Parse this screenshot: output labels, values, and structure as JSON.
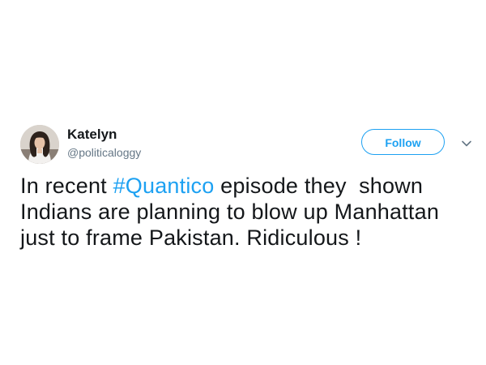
{
  "author": {
    "display_name": "Katelyn",
    "handle": "@politicaloggy",
    "avatar_icon": "profile-photo"
  },
  "actions": {
    "follow_label": "Follow",
    "menu_icon": "chevron-down-icon"
  },
  "tweet": {
    "line1_before": "In recent ",
    "hashtag": "#Quantico",
    "line1_after": " episode they  shown",
    "line2": "Indians are planning to blow up Manhattan",
    "line3": "just to frame Pakistan. Ridiculous !"
  },
  "colors": {
    "accent": "#1da1f2",
    "text": "#14171a",
    "muted": "#657786"
  }
}
